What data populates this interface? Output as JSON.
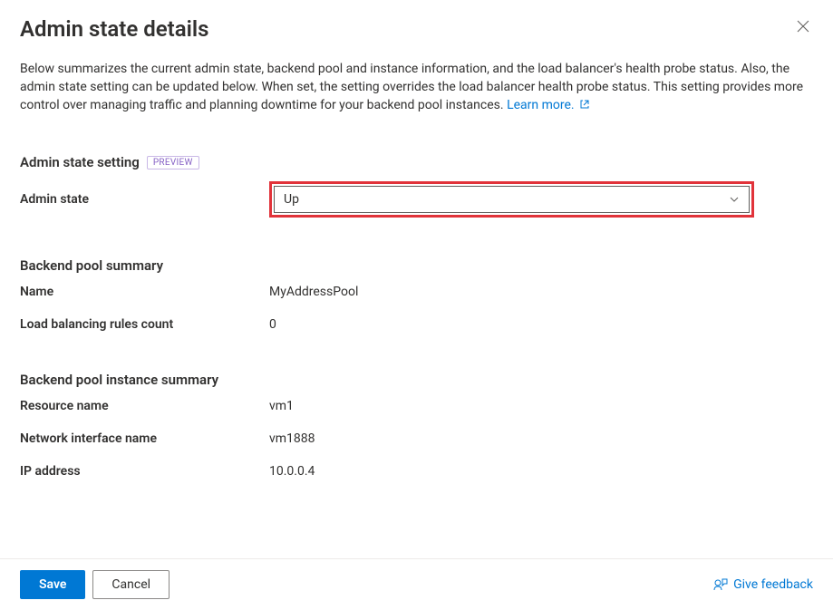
{
  "header": {
    "title": "Admin state details"
  },
  "description": {
    "text": "Below summarizes the current admin state, backend pool and instance information, and the load balancer's health probe status. Also, the admin state setting can be updated below. When set, the setting overrides the load balancer health probe status. This setting provides more control over managing traffic and planning downtime for your backend pool instances.",
    "learn_more": "Learn more."
  },
  "admin_state_section": {
    "heading": "Admin state setting",
    "badge": "PREVIEW",
    "field_label": "Admin state",
    "selected_value": "Up"
  },
  "backend_pool_section": {
    "heading": "Backend pool summary",
    "rows": [
      {
        "label": "Name",
        "value": "MyAddressPool"
      },
      {
        "label": "Load balancing rules count",
        "value": "0"
      }
    ]
  },
  "instance_section": {
    "heading": "Backend pool instance summary",
    "rows": [
      {
        "label": "Resource name",
        "value": "vm1"
      },
      {
        "label": "Network interface name",
        "value": "vm1888"
      },
      {
        "label": "IP address",
        "value": "10.0.0.4"
      }
    ]
  },
  "footer": {
    "save": "Save",
    "cancel": "Cancel",
    "feedback": "Give feedback"
  }
}
